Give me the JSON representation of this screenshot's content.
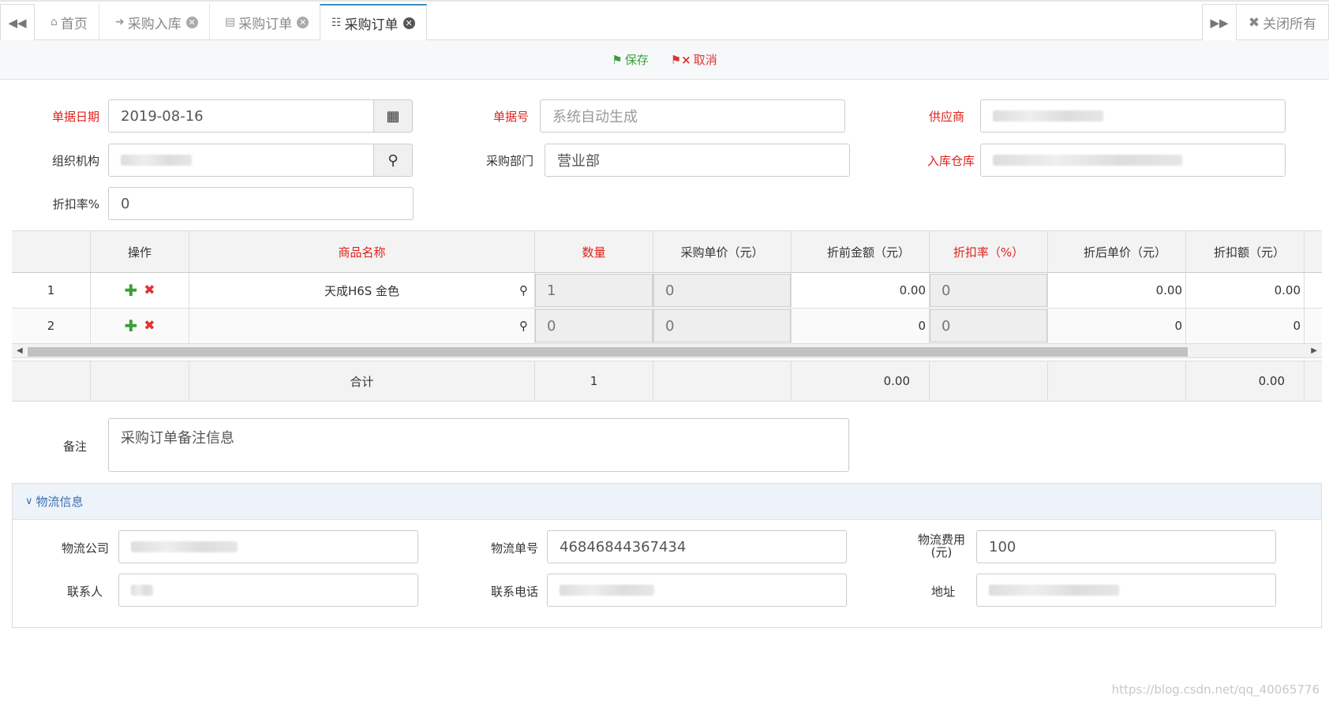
{
  "tabs": {
    "home": "首页",
    "purchase_in": "采购入库",
    "purchase_order_1": "采购订单",
    "purchase_order_2": "采购订单",
    "close_all": "关闭所有"
  },
  "toolbar": {
    "save": "保存",
    "cancel": "取消"
  },
  "form": {
    "date_label": "单据日期",
    "date_value": "2019-08-16",
    "docno_label": "单据号",
    "docno_placeholder": "系统自动生成",
    "supplier_label": "供应商",
    "org_label": "组织机构",
    "dept_label": "采购部门",
    "dept_value": "营业部",
    "warehouse_label": "入库仓库",
    "discount_label": "折扣率%",
    "discount_value": "0"
  },
  "grid": {
    "headers": [
      "操作",
      "商品名称",
      "数量",
      "采购单价（元）",
      "折前金额（元）",
      "折扣率（%）",
      "折后单价（元）",
      "折扣额（元）"
    ],
    "rows": [
      {
        "no": "1",
        "name": "天成H6S 金色",
        "qty": "1",
        "price": "0",
        "amount": "0.00",
        "rate": "0",
        "after_price": "0.00",
        "discount_amt": "0.00"
      },
      {
        "no": "2",
        "name": "",
        "qty": "0",
        "price": "0",
        "amount": "0",
        "rate": "0",
        "after_price": "0",
        "discount_amt": "0"
      }
    ],
    "footer": {
      "label": "合计",
      "qty": "1",
      "amount": "0.00",
      "discount_amt": "0.00"
    }
  },
  "remark": {
    "label": "备注",
    "value": "采购订单备注信息"
  },
  "logistics": {
    "title": "物流信息",
    "company_label": "物流公司",
    "waybill_label": "物流单号",
    "waybill_value": "46846844367434",
    "fee_label_1": "物流费用",
    "fee_label_2": "(元)",
    "fee_value": "100",
    "contact_label": "联系人",
    "phone_label": "联系电话",
    "address_label": "地址"
  },
  "watermark": "https://blog.csdn.net/qq_40065776"
}
